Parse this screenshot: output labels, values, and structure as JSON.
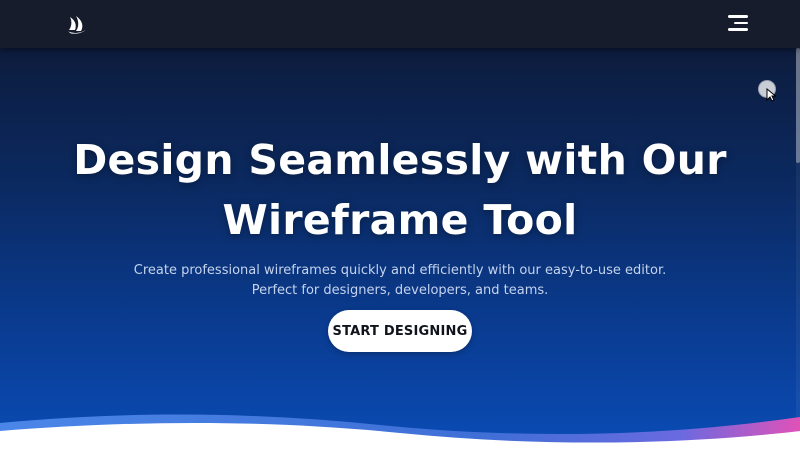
{
  "nav": {
    "logo_icon": "sail-logo-icon",
    "menu_icon": "hamburger-menu-icon"
  },
  "hero": {
    "headline_line1": "Design Seamlessly with Our",
    "headline_line2": "Wireframe Tool",
    "subtext_line1": "Create professional wireframes quickly and efficiently with our easy-to-use editor.",
    "subtext_line2": "Perfect for designers, developers, and teams.",
    "cta_label": "START DESIGNING"
  },
  "colors": {
    "nav_bg": "#161c2c",
    "hero_gradient_top": "#0d1c3d",
    "hero_gradient_bottom": "#0a4cb6",
    "wave_blue": "#3f7be0",
    "wave_pink": "#e052b8",
    "cta_bg": "#ffffff"
  }
}
